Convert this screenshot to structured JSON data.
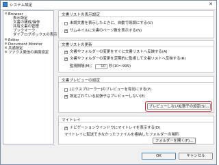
{
  "window": {
    "title": "システム設定",
    "close": "✕"
  },
  "tree": {
    "items": [
      {
        "toggle": "⊟",
        "label": "Browser"
      },
      {
        "toggle": "",
        "label": "表示設定"
      },
      {
        "toggle": "",
        "label": "文書の構成/操作"
      },
      {
        "toggle": "",
        "label": "共有文書の管理"
      },
      {
        "toggle": "",
        "label": "ブックマーク"
      },
      {
        "toggle": "",
        "label": "ダイアログボックスの表示"
      },
      {
        "toggle": "⊞",
        "label": "Editor"
      },
      {
        "toggle": "⊞",
        "label": "Document Monitor"
      },
      {
        "toggle": "⊞",
        "label": "共通設定"
      },
      {
        "toggle": "⊞",
        "label": "ファクス発信の画面設定"
      }
    ]
  },
  "list_display": {
    "title": "文書リストの表示設定",
    "options": [
      {
        "label": "未読文書を表示したときに、自動で既読にする(U)",
        "checked": false
      },
      {
        "label": "サムネイルに文書のページ数を表示する(N)",
        "checked": true
      }
    ]
  },
  "list_refresh": {
    "title": "文書リストの更新",
    "options": [
      {
        "label": "文書やフォルダーの変更をすぐに文書リストへ反映する(A)",
        "checked": true
      },
      {
        "label": "文書やフォルダーの変更を定期的に監視して文書リストへ反映する(R)",
        "checked": true
      }
    ],
    "interval_label": "監視間隔(M)：",
    "interval_value": "10",
    "interval_unit": "秒(10〜999)"
  },
  "preview": {
    "title": "文書プレビューの設定",
    "options": [
      {
        "label": "[エクスプローラー]のプレビューを有効にする(P)",
        "checked": false
      },
      {
        "label": "設定されている拡張子はプレビューしない(E)",
        "checked": true
      }
    ],
    "exclude_button": "プレビューしない拡張子の設定(S)..."
  },
  "mytray": {
    "title": "マイトレイ",
    "options": [
      {
        "label": "ナビゲーションウインドウにマイトレイを表示する(D)",
        "checked": true
      }
    ],
    "note": "マイトレイに転送できなかったファイルを格納したフォルダーの場所",
    "folder_button": "フォルダーを開く(F)..."
  },
  "footer": {
    "ok": "OK",
    "cancel": "キャンセル"
  },
  "colors": {
    "highlight": "#e4141c",
    "accent": "#3b7fd4"
  }
}
